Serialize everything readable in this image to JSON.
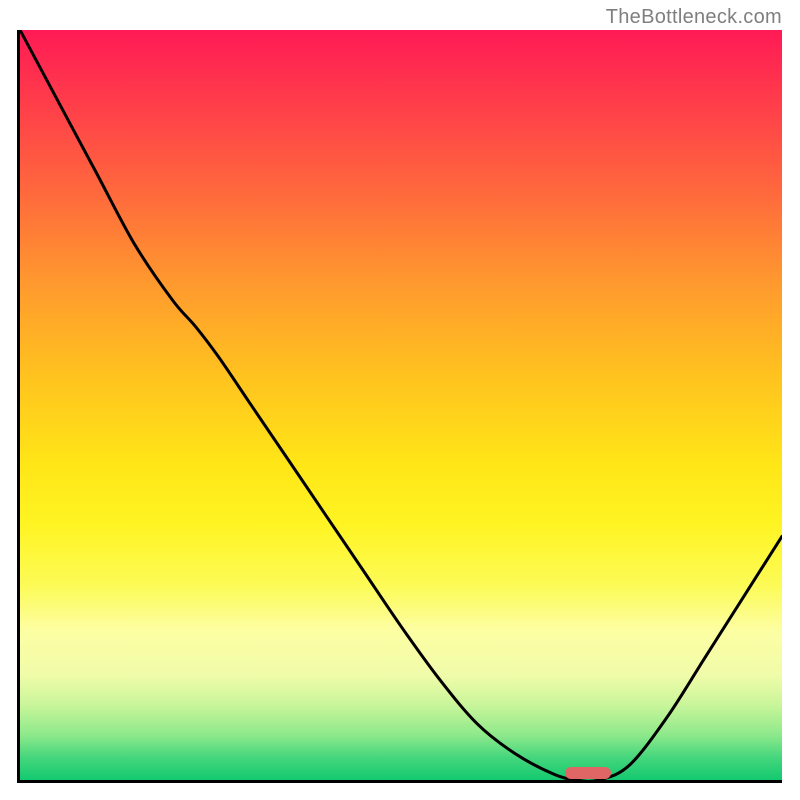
{
  "watermark": "TheBottleneck.com",
  "chart_data": {
    "type": "line",
    "x": [
      0.0,
      0.05,
      0.1,
      0.15,
      0.2,
      0.23,
      0.26,
      0.3,
      0.35,
      0.4,
      0.45,
      0.5,
      0.55,
      0.6,
      0.65,
      0.7,
      0.73,
      0.76,
      0.8,
      0.85,
      0.9,
      0.95,
      1.0
    ],
    "values": [
      1.0,
      0.905,
      0.81,
      0.715,
      0.64,
      0.605,
      0.565,
      0.505,
      0.43,
      0.355,
      0.28,
      0.205,
      0.135,
      0.075,
      0.035,
      0.008,
      0.0,
      0.0,
      0.02,
      0.085,
      0.165,
      0.245,
      0.325
    ],
    "title": "",
    "xlabel": "",
    "ylabel": "",
    "xlim": [
      0,
      1
    ],
    "ylim": [
      0,
      1
    ],
    "gradient_stops": [
      {
        "pos": 0.0,
        "color": "#ff1a55"
      },
      {
        "pos": 0.5,
        "color": "#ffd21c"
      },
      {
        "pos": 0.8,
        "color": "#fdfea2"
      },
      {
        "pos": 1.0,
        "color": "#13c96f"
      }
    ],
    "marker": {
      "x0": 0.715,
      "x1": 0.775,
      "y": 0.009,
      "color": "#e06666"
    },
    "line_color": "#000000",
    "line_width": 3
  }
}
